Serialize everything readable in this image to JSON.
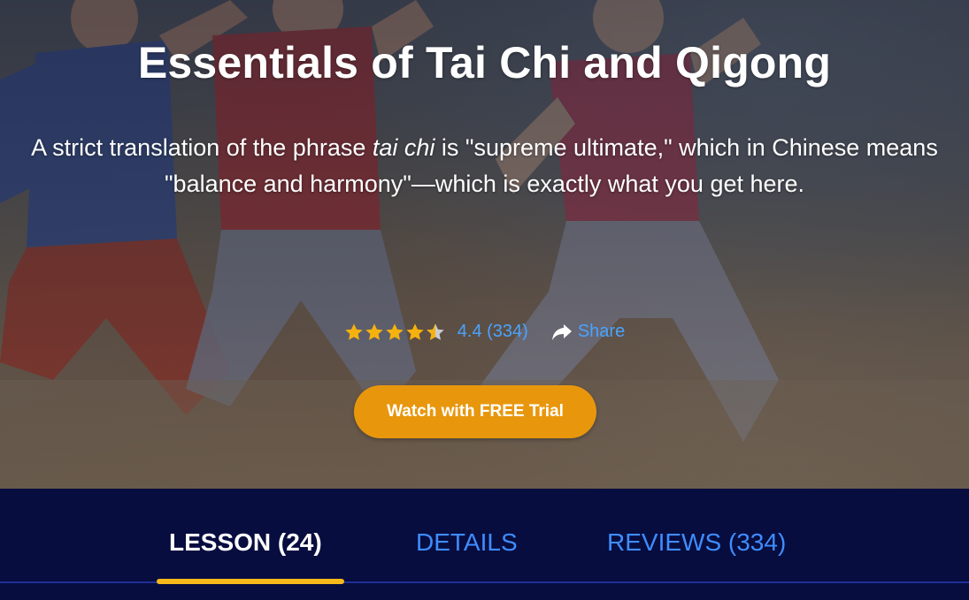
{
  "hero": {
    "title": "Essentials of Tai Chi and Qigong",
    "description_before": "A strict translation of the phrase ",
    "description_italic": "tai chi",
    "description_after": " is \"supreme ultimate,\" which in Chinese means \"balance and harmony\"—which is exactly what you get here.",
    "background_image": "tai-chi-practitioners-photo"
  },
  "rating": {
    "stars": 4.4,
    "value": "4.4",
    "count": "(334)",
    "star_color": "#f5b20f",
    "star_empty_color": "#c9cbd3"
  },
  "share": {
    "label": "Share",
    "icon": "share-arrow-icon"
  },
  "cta": {
    "label": "Watch with FREE Trial",
    "color": "#e8970d"
  },
  "tabs": [
    {
      "label": "LESSON (24)",
      "active": true
    },
    {
      "label": "DETAILS",
      "active": false
    },
    {
      "label": "REVIEWS (334)",
      "active": false
    }
  ],
  "colors": {
    "tabbar_bg": "#070d3f",
    "tab_active": "#ffffff",
    "tab_inactive": "#3f8cff",
    "tab_indicator": "#f5b91a",
    "link": "#4aa3ff"
  }
}
